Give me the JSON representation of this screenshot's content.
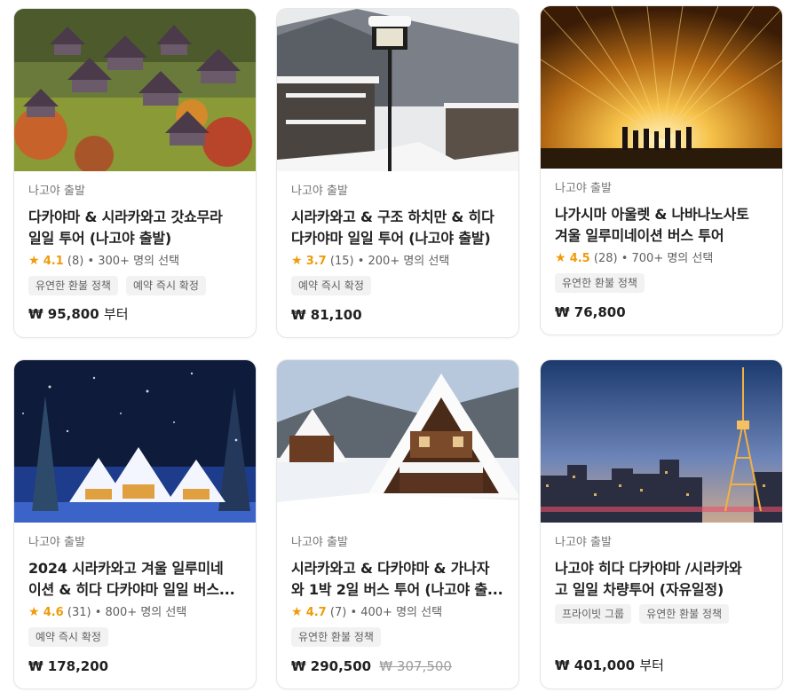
{
  "cards": [
    {
      "location": "나고야 출발",
      "title_line1": "다카야마 & 시라카와고 갓쇼무라",
      "title_line2": "일일 투어 (나고야 출발)",
      "rating": "4.1",
      "reviews": "(8)",
      "selected": "• 300+ 명의 선택",
      "tags": [
        "유연한 환불 정책",
        "예약 즉시 확정"
      ],
      "price": "₩ 95,800",
      "price_suffix": "부터",
      "old_price": ""
    },
    {
      "location": "나고야 출발",
      "title_line1": "시라카와고 & 구조 하치만 & 히다",
      "title_line2": "다카야마 일일 투어 (나고야 출발)",
      "rating": "3.7",
      "reviews": "(15)",
      "selected": "• 200+ 명의 선택",
      "tags": [
        "예약 즉시 확정"
      ],
      "price": "₩ 81,100",
      "price_suffix": "",
      "old_price": ""
    },
    {
      "location": "나고야 출발",
      "title_line1": "나가시마 아울렛 & 나바나노사토",
      "title_line2": "겨울 일루미네이션 버스 투어",
      "rating": "4.5",
      "reviews": "(28)",
      "selected": "• 700+ 명의 선택",
      "tags": [
        "유연한 환불 정책"
      ],
      "price": "₩ 76,800",
      "price_suffix": "",
      "old_price": ""
    },
    {
      "location": "나고야 출발",
      "title_line1": "2024 시라카와고 겨울 일루미네",
      "title_line2": "이션 & 히다 다카야마 일일 버스...",
      "rating": "4.6",
      "reviews": "(31)",
      "selected": "• 800+ 명의 선택",
      "tags": [
        "예약 즉시 확정"
      ],
      "price": "₩ 178,200",
      "price_suffix": "",
      "old_price": ""
    },
    {
      "location": "나고야 출발",
      "title_line1": "시라카와고 & 다카야마 & 가나자",
      "title_line2": "와 1박 2일 버스 투어 (나고야 출...",
      "rating": "4.7",
      "reviews": "(7)",
      "selected": "• 400+ 명의 선택",
      "tags": [
        "유연한 환불 정책"
      ],
      "price": "₩ 290,500",
      "price_suffix": "",
      "old_price": "₩ 307,500"
    },
    {
      "location": "나고야 출발",
      "title_line1": "나고야 히다 다카야마 /시라카와",
      "title_line2": "고 일일 차량투어 (자유일정)",
      "rating": "",
      "reviews": "",
      "selected": "",
      "tags": [
        "프라이빗 그룹",
        "유연한 환불 정책"
      ],
      "price": "₩ 401,000",
      "price_suffix": "부터",
      "old_price": ""
    }
  ],
  "images": [
    "shirakawago-village-photo",
    "snowy-onsen-street-photo",
    "light-tunnel-photo",
    "winter-illumination-photo",
    "snowy-gassho-house-photo",
    "nagoya-tv-tower-photo"
  ],
  "colors": {
    "star": "#f09b0a",
    "tag_bg": "#f2f2f2",
    "border": "#e6e6e6"
  }
}
